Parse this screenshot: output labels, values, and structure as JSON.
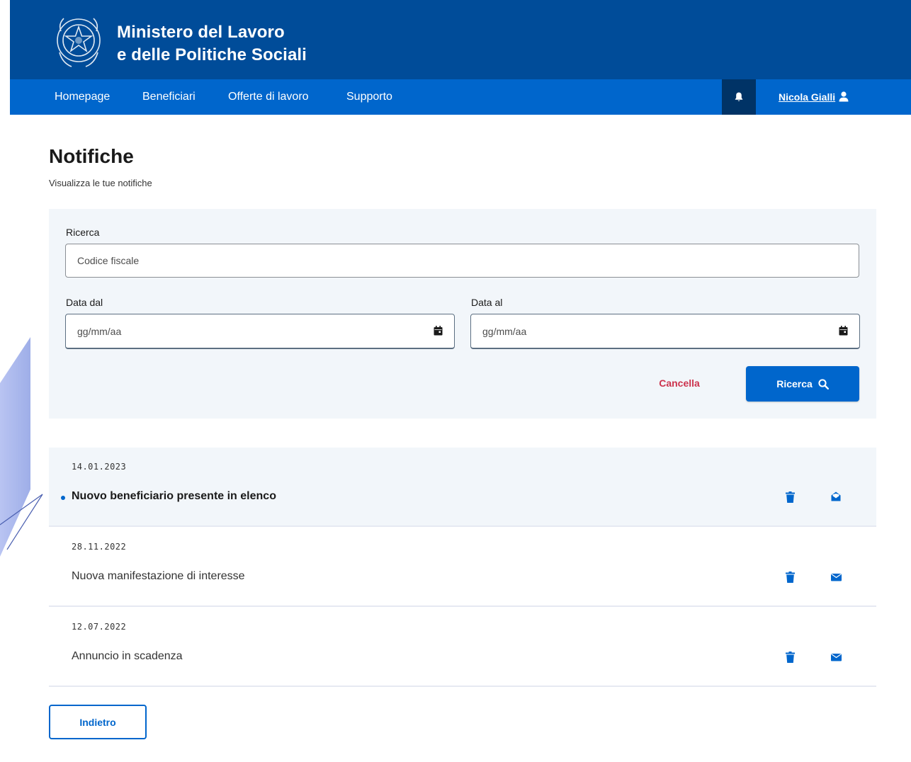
{
  "header": {
    "ministry_line1": "Ministero del Lavoro",
    "ministry_line2": "e delle Politiche Sociali",
    "emblem_icon": "italian-republic-emblem",
    "colors": {
      "top": "#004c99",
      "nav": "#0066cc",
      "bell_box": "#003366"
    }
  },
  "nav": {
    "items": [
      {
        "label": "Homepage"
      },
      {
        "label": "Beneficiari"
      },
      {
        "label": "Offerte di lavoro"
      },
      {
        "label": "Supporto"
      }
    ],
    "bell_icon": "bell-icon",
    "user_name": "Nicola Gialli",
    "user_icon": "user-icon"
  },
  "page": {
    "title": "Notifiche",
    "subtitle": "Visualizza le tue notifiche"
  },
  "search": {
    "label": "Ricerca",
    "placeholder": "Codice fiscale",
    "date_from_label": "Data dal",
    "date_from_placeholder": "gg/mm/aa",
    "date_to_label": "Data al",
    "date_to_placeholder": "gg/mm/aa",
    "cancel_label": "Cancella",
    "submit_label": "Ricerca",
    "submit_icon": "search-icon",
    "colors": {
      "cancel": "#cc334d",
      "primary": "#0066cc"
    }
  },
  "notifications": [
    {
      "date": "14.01.2023",
      "text": "Nuovo beneficiario presente in elenco",
      "unread": true,
      "mail_icon": "envelope-open-icon"
    },
    {
      "date": "28.11.2022",
      "text": "Nuova manifestazione di interesse",
      "unread": false,
      "mail_icon": "envelope-icon"
    },
    {
      "date": "12.07.2022",
      "text": "Annuncio in scadenza",
      "unread": false,
      "mail_icon": "envelope-icon"
    }
  ],
  "back_label": "Indietro"
}
